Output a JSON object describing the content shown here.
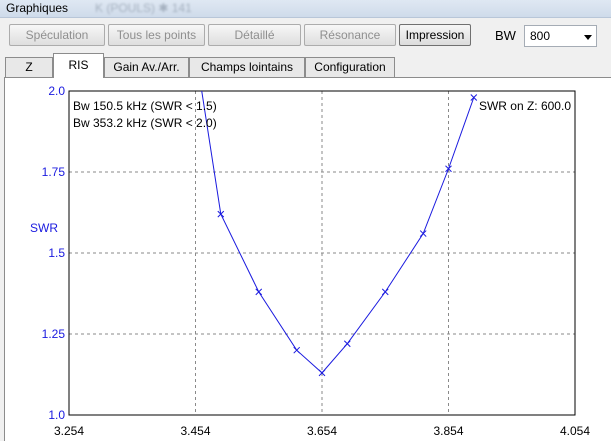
{
  "window": {
    "title": "Graphiques",
    "blurred_title": "K (POULS) ✱ 141"
  },
  "toolbar": {
    "speculation": "Spéculation",
    "all_points": "Tous les points",
    "detailed": "Détaillé",
    "resonance": "Résonance",
    "print": "Impression"
  },
  "bw": {
    "label": "BW",
    "value": "800"
  },
  "tabs": [
    "Z",
    "RIS",
    "Gain Av./Arr.",
    "Champs lointains",
    "Configuration"
  ],
  "selected_tab": "RIS",
  "chart_data": {
    "type": "line",
    "ylabel": "SWR",
    "xlim": [
      3.254,
      4.054
    ],
    "ylim": [
      1.0,
      2.0
    ],
    "x_ticks": [
      "3.254",
      "3.454",
      "3.654",
      "3.854",
      "4.054"
    ],
    "y_ticks": [
      "2.0",
      "1.75",
      "1.5",
      "1.25",
      "1.0"
    ],
    "grid": true,
    "annotations": [
      "Bw 150.5 kHz (SWR < 1.5)",
      "Bw 353.2 kHz (SWR < 2.0)",
      "SWR on Z: 600.0"
    ],
    "series": [
      {
        "color": "#1a1adf",
        "x": [
          3.444,
          3.494,
          3.554,
          3.614,
          3.654,
          3.694,
          3.754,
          3.814,
          3.854,
          3.894
        ],
        "y": [
          2.25,
          1.62,
          1.38,
          1.2,
          1.13,
          1.22,
          1.38,
          1.56,
          1.76,
          1.98
        ]
      }
    ],
    "marker": "x"
  }
}
